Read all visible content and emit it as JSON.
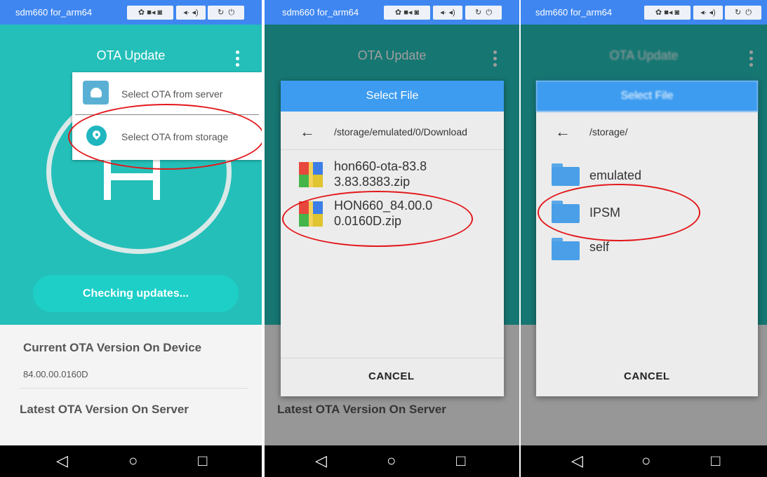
{
  "emulator": {
    "title": "sdm660 for_arm64",
    "controls": [
      "gear-icon",
      "video-icon",
      "camera-icon",
      "volume-down-icon",
      "volume-up-icon",
      "rotate-icon",
      "power-icon"
    ]
  },
  "app": {
    "title": "OTA Update",
    "menu": {
      "items": [
        {
          "label": "Select OTA from server",
          "icon": "cloud-android-icon"
        },
        {
          "label": "Select OTA from storage",
          "icon": "location-pin-icon"
        }
      ]
    },
    "check_button_label": "Checking updates...",
    "current_version_heading": "Current OTA Version On Device",
    "current_version_value": "84.00.00.0160D",
    "latest_version_heading": "Latest OTA Version On Server"
  },
  "dialog1": {
    "title": "Select File",
    "path": "/storage/emulated/0/Download",
    "files": [
      {
        "line1": "hon660-ota-83.8",
        "line2": "3.83.8383.zip"
      },
      {
        "line1": "HON660_84.00.0",
        "line2": "0.0160D.zip"
      }
    ],
    "cancel_label": "CANCEL"
  },
  "dialog2": {
    "title": "Select File",
    "path": "/storage/",
    "folders": [
      "emulated",
      "IPSM",
      "self"
    ],
    "cancel_label": "CANCEL"
  },
  "colors": {
    "emulator_bar": "#3f86f0",
    "teal": "#24bfb9",
    "dialog_header": "#3d9cf0",
    "highlight_red": "#e3171b"
  }
}
